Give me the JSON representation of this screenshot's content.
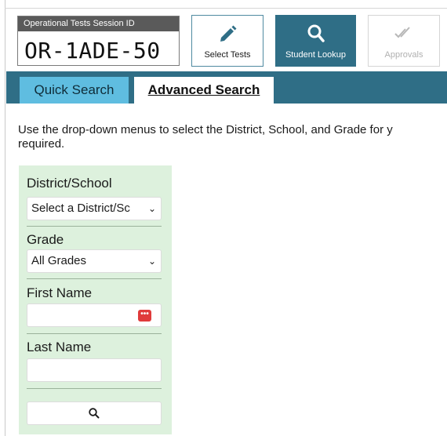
{
  "session": {
    "label": "Operational Tests  Session ID",
    "id": "OR-1ADE-50"
  },
  "toolbar": {
    "select_tests_label": "Select Tests",
    "student_lookup_label": "Student Lookup",
    "approvals_label": "Approvals"
  },
  "tabs": {
    "quick": "Quick Search",
    "advanced": "Advanced Search"
  },
  "instructions": {
    "line1": "Use the drop-down menus to select the District, School, and Grade for y",
    "line2": "required."
  },
  "form": {
    "district_label": "District/School",
    "district_value": "Select a District/Sc",
    "grade_label": "Grade",
    "grade_value": "All Grades",
    "first_name_label": "First Name",
    "first_name_value": "",
    "last_name_label": "Last Name",
    "last_name_value": ""
  },
  "colors": {
    "header_teal": "#2f6e86",
    "quick_tab": "#5fbde0",
    "panel_green": "#ddf1dd"
  },
  "icons": {
    "select_tests": "pencil-icon",
    "student_lookup": "search-icon",
    "approvals": "double-check-icon",
    "password_manager": "password-manager-icon",
    "search_button": "search-icon"
  }
}
